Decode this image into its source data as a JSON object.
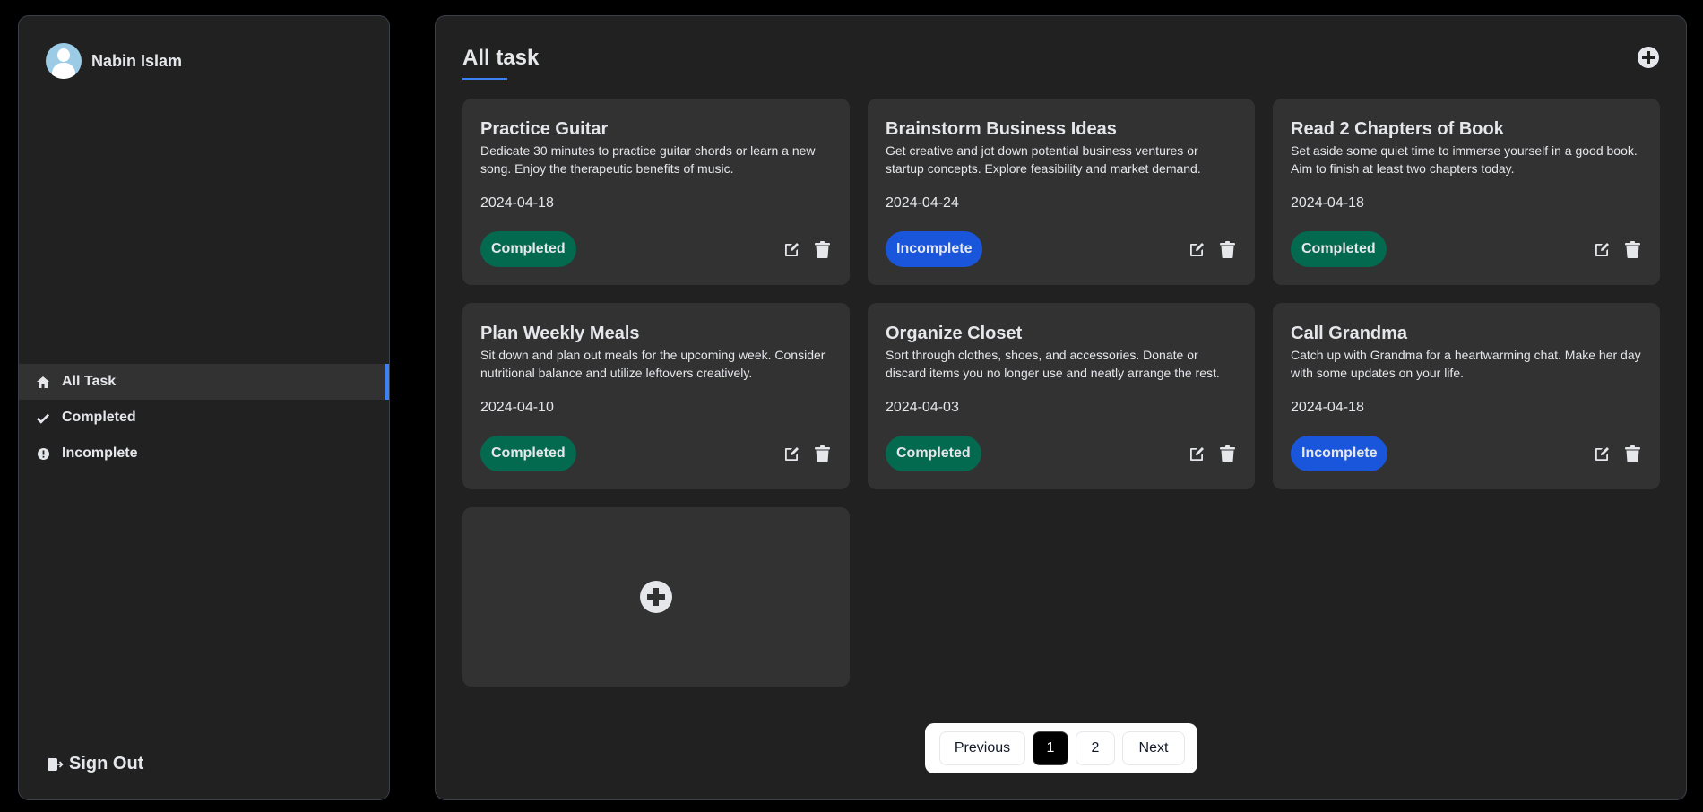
{
  "user": {
    "name": "Nabin Islam"
  },
  "sidebar": {
    "items": [
      {
        "label": "All Task",
        "icon": "home-icon",
        "active": true
      },
      {
        "label": "Completed",
        "icon": "check-icon",
        "active": false
      },
      {
        "label": "Incomplete",
        "icon": "exclamation-circle-icon",
        "active": false
      }
    ],
    "signout_label": "Sign Out"
  },
  "main": {
    "title": "All task",
    "accent_color": "#3b82f6",
    "tasks": [
      {
        "title": "Practice Guitar",
        "description": "Dedicate 30 minutes to practice guitar chords or learn a new song. Enjoy the therapeutic benefits of music.",
        "date": "2024-04-18",
        "status": "Completed"
      },
      {
        "title": "Brainstorm Business Ideas",
        "description": "Get creative and jot down potential business ventures or startup concepts. Explore feasibility and market demand.",
        "date": "2024-04-24",
        "status": "Incomplete"
      },
      {
        "title": "Read 2 Chapters of Book",
        "description": "Set aside some quiet time to immerse yourself in a good book. Aim to finish at least two chapters today.",
        "date": "2024-04-18",
        "status": "Completed"
      },
      {
        "title": "Plan Weekly Meals",
        "description": "Sit down and plan out meals for the upcoming week. Consider nutritional balance and utilize leftovers creatively.",
        "date": "2024-04-10",
        "status": "Completed"
      },
      {
        "title": "Organize Closet",
        "description": "Sort through clothes, shoes, and accessories. Donate or discard items you no longer use and neatly arrange the rest.",
        "date": "2024-04-03",
        "status": "Completed"
      },
      {
        "title": "Call Grandma",
        "description": "Catch up with Grandma for a heartwarming chat. Make her day with some updates on your life.",
        "date": "2024-04-18",
        "status": "Incomplete"
      }
    ],
    "status_colors": {
      "Completed": "#03694f",
      "Incomplete": "#1a56db"
    }
  },
  "pagination": {
    "previous_label": "Previous",
    "pages": [
      "1",
      "2"
    ],
    "current_page": "1",
    "next_label": "Next"
  }
}
